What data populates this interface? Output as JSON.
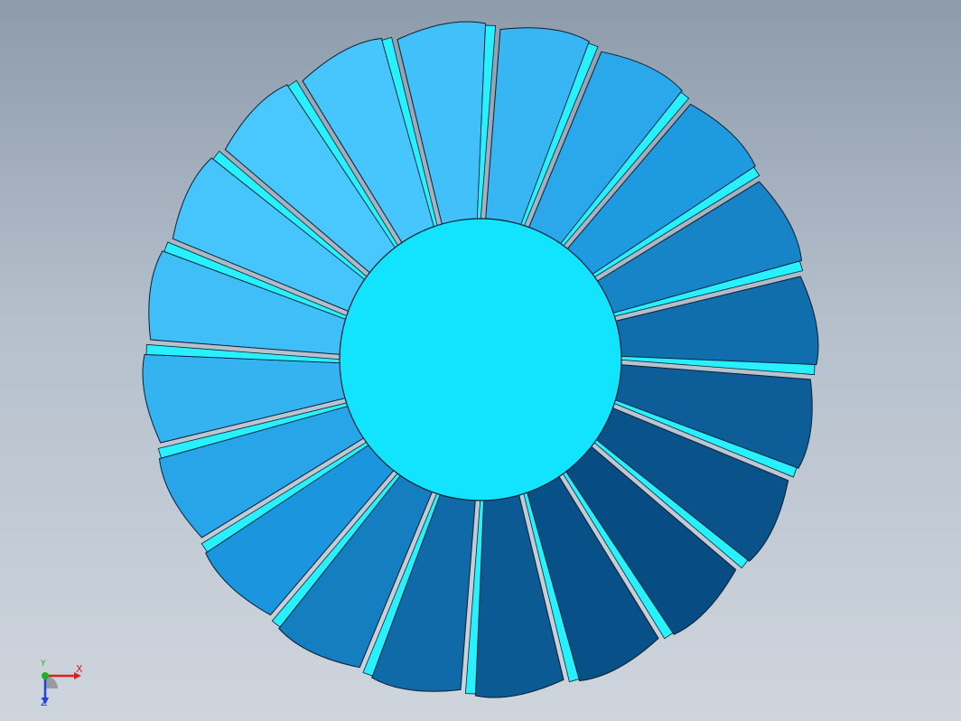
{
  "window": {
    "background_top": "#8d9bab",
    "background_bottom": "#cfd5dd"
  },
  "model": {
    "description_name": "turbine-impeller",
    "blade_count": 20,
    "hub_color": "#12e3ff",
    "blade_color_light": "#49c8ff",
    "blade_color_mid": "#1c98e0",
    "blade_color_dark": "#05457a",
    "blade_edge_color": "#27f0ff",
    "outline_color": "#0b1f33"
  },
  "triad": {
    "x_label": "X",
    "y_label": "Y",
    "z_label": "Z",
    "x_color": "#e02020",
    "y_color": "#20b020",
    "z_color": "#2040e0"
  }
}
